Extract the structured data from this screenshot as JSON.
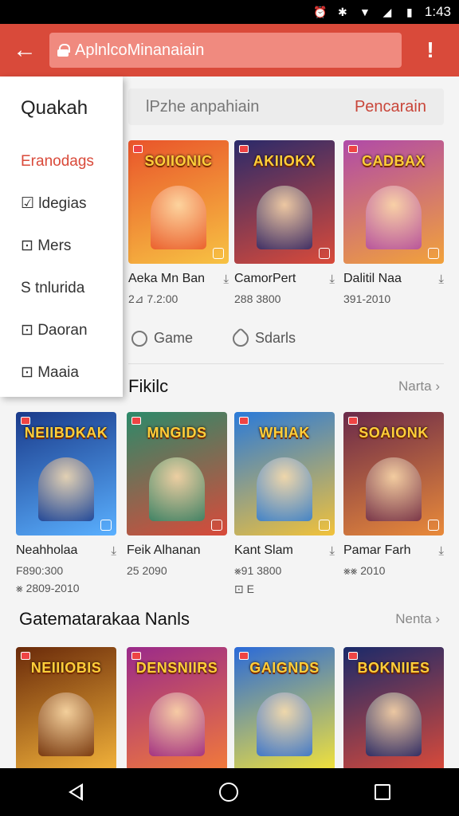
{
  "status_bar": {
    "time": "1:43",
    "icons": [
      "alarm-icon",
      "vibrate-icon",
      "wifi-icon",
      "signal-icon",
      "battery-icon"
    ]
  },
  "app_bar": {
    "url_text": "AplnlcoMinanaiain",
    "back_icon": "arrow-left-icon",
    "menu_icon": "more-vert-icon"
  },
  "drawer": {
    "title": "Quakah",
    "items": [
      {
        "label": "Eranodags",
        "active": true
      },
      {
        "label": "☑ ldegias",
        "active": false
      },
      {
        "label": "⊡ Mers",
        "active": false
      },
      {
        "label": "S tnlurida",
        "active": false
      },
      {
        "label": "⊡ Daoran",
        "active": false
      },
      {
        "label": "⊡ Maaia",
        "active": false
      }
    ]
  },
  "search": {
    "placeholder": "lPzhe anpahiain",
    "button_label": "Pencarain"
  },
  "row1": [
    {
      "title": "Aeka Mn Ban",
      "meta": "2⊿ 7.2:00",
      "logo": "SOIIONIC",
      "bg": [
        "#e9542a",
        "#f7c243"
      ]
    },
    {
      "title": "CamorPert",
      "meta": "288 3800",
      "logo": "AKIIOKX",
      "bg": [
        "#2a2a6a",
        "#d94a3a"
      ]
    },
    {
      "title": "Dalitil Naa",
      "meta": "391-2010",
      "logo": "CADBAX",
      "bg": [
        "#b04aa8",
        "#f2a23a"
      ]
    }
  ],
  "chips": [
    {
      "label": "Game",
      "icon": "gamepad-icon"
    },
    {
      "label": "Sdarls",
      "icon": "pen-icon"
    }
  ],
  "section1": {
    "title": "Fikilc",
    "more": "Narta"
  },
  "row2": [
    {
      "title": "Neahholaa",
      "meta": "F890:300",
      "meta2": "⨳ 2809-2010",
      "logo": "NEIIBDKAK",
      "bg": [
        "#1a3a8a",
        "#5ab0ff"
      ]
    },
    {
      "title": "Feik Alhanan",
      "meta": "25 2090",
      "logo": "MNGIDS",
      "bg": [
        "#2c8a6a",
        "#d94a3a"
      ]
    },
    {
      "title": "Kant Slam",
      "meta": "⨳91 3800",
      "meta2": "⊡ E",
      "logo": "WHIAK",
      "bg": [
        "#2a7ad9",
        "#f2c23a"
      ]
    },
    {
      "title": "Pamar Farh",
      "meta": "⨳⨳ 2010",
      "logo": "SOAIONK",
      "bg": [
        "#6a2a4a",
        "#e98a3a"
      ]
    }
  ],
  "section2": {
    "title": "Gatematarakaa Nanls",
    "more": "Nenta"
  },
  "row3": [
    {
      "logo": "NEIIIOBIS",
      "bg": [
        "#6a2a0a",
        "#f2b23a"
      ]
    },
    {
      "logo": "DENSNIIRS",
      "bg": [
        "#9a2a8a",
        "#f27a3a"
      ]
    },
    {
      "logo": "GAIGNDS",
      "bg": [
        "#2a6ad9",
        "#f2e23a"
      ]
    },
    {
      "logo": "BOKNIIES",
      "bg": [
        "#1a2a6a",
        "#d94a3a"
      ]
    }
  ],
  "colors": {
    "accent": "#d94a3a",
    "accent_light": "#f08a7f"
  }
}
